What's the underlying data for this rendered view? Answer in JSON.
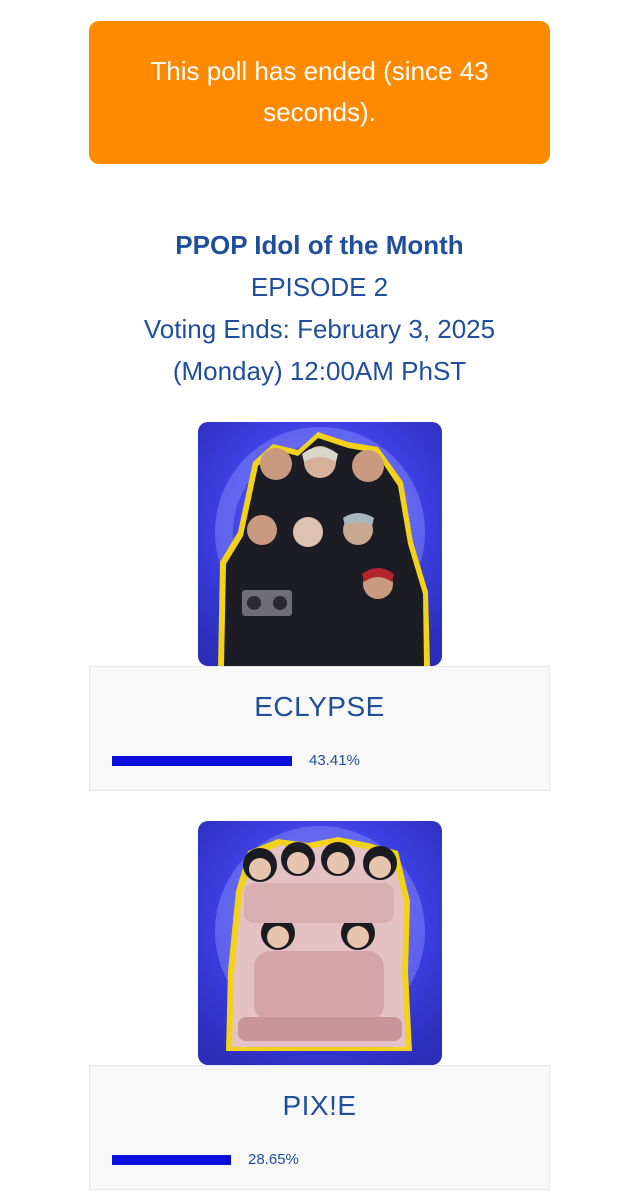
{
  "notice": {
    "text": "This poll has ended (since 43 seconds).",
    "color": "#ff8a00"
  },
  "header": {
    "title": "PPOP Idol of the Month",
    "episode": "EPISODE 2",
    "voting_ends": "Voting Ends: February 3, 2025",
    "time": "(Monday) 12:00AM PhST"
  },
  "candidates": [
    {
      "name": "ECLYPSE",
      "percent_label": "43.41%",
      "share": 0.4341,
      "photo": "group-photo-eclypse"
    },
    {
      "name": "PIX!E",
      "percent_label": "28.65%",
      "share": 0.2865,
      "photo": "group-photo-pixie"
    }
  ],
  "colors": {
    "accent_text": "#1f4e9c",
    "bar": "#0a10dc",
    "photo_bg": "#3b3fe0"
  }
}
